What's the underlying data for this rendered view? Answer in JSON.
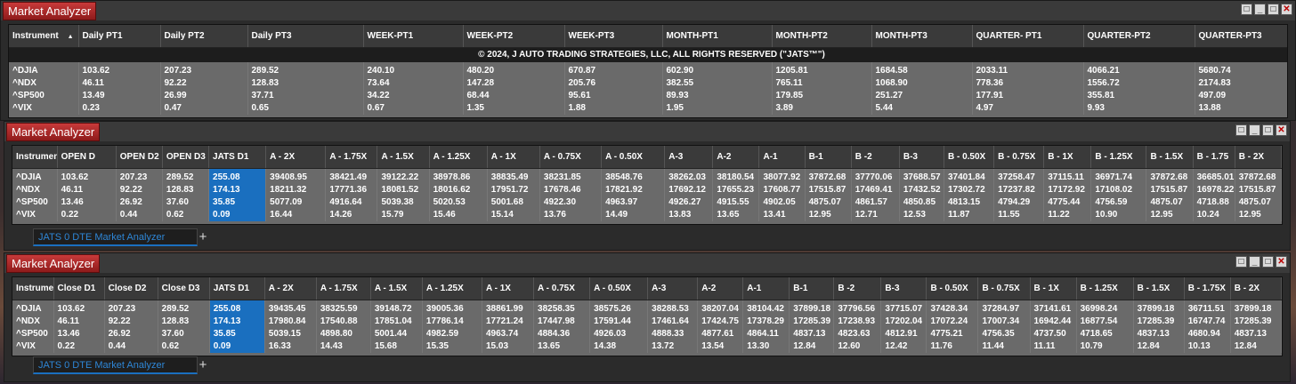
{
  "win1": {
    "title": "Market Analyzer",
    "headers": [
      "Instrument",
      "Daily PT1",
      "Daily PT2",
      "Daily PT3",
      "WEEK-PT1",
      "WEEK-PT2",
      "WEEK-PT3",
      "MONTH-PT1",
      "MONTH-PT2",
      "MONTH-PT3",
      "QUARTER- PT1",
      "QUARTER-PT2",
      "QUARTER-PT3"
    ],
    "sort_indicator": "▲",
    "copyright": "© 2024, J AUTO TRADING STRATEGIES, LLC, ALL RIGHTS RESERVED (\"JATS™\")",
    "rows": [
      [
        "^DJIA",
        "103.62",
        "207.23",
        "289.52",
        "240.10",
        "480.20",
        "670.87",
        "602.90",
        "1205.81",
        "1684.58",
        "2033.11",
        "4066.21",
        "5680.74"
      ],
      [
        "^NDX",
        "46.11",
        "92.22",
        "128.83",
        "73.64",
        "147.28",
        "205.76",
        "382.55",
        "765.11",
        "1068.90",
        "778.36",
        "1556.72",
        "2174.83"
      ],
      [
        "^SP500",
        "13.49",
        "26.99",
        "37.71",
        "34.22",
        "68.44",
        "95.61",
        "89.93",
        "179.85",
        "251.27",
        "177.91",
        "355.81",
        "497.09"
      ],
      [
        "^VIX",
        "0.23",
        "0.47",
        "0.65",
        "0.67",
        "1.35",
        "1.88",
        "1.95",
        "3.89",
        "5.44",
        "4.97",
        "9.93",
        "13.88"
      ]
    ]
  },
  "win2": {
    "title": "Market Analyzer",
    "headers": [
      "Instrument",
      "OPEN D",
      "OPEN D2",
      "OPEN D3",
      "JATS D1",
      "A - 2X",
      "A - 1.75X",
      "A - 1.5X",
      "A - 1.25X",
      "A - 1X",
      "A - 0.75X",
      "A - 0.50X",
      "A-3",
      "A-2",
      "A-1",
      "B-1",
      "B -2",
      "B-3",
      "B - 0.50X",
      "B - 0.75X",
      "B - 1X",
      "B - 1.25X",
      "B - 1.5X",
      "B - 1.75",
      "B - 2X"
    ],
    "rows": [
      [
        "^DJIA",
        "103.62",
        "207.23",
        "289.52",
        "255.08",
        "39408.95",
        "38421.49",
        "39122.22",
        "38978.86",
        "38835.49",
        "38231.85",
        "38548.76",
        "38262.03",
        "38180.54",
        "38077.92",
        "37872.68",
        "37770.06",
        "37688.57",
        "37401.84",
        "37258.47",
        "37115.11",
        "36971.74",
        "37872.68",
        "36685.01",
        "37872.68"
      ],
      [
        "^NDX",
        "46.11",
        "92.22",
        "128.83",
        "174.13",
        "18211.32",
        "17771.36",
        "18081.52",
        "18016.62",
        "17951.72",
        "17678.46",
        "17821.92",
        "17692.12",
        "17655.23",
        "17608.77",
        "17515.87",
        "17469.41",
        "17432.52",
        "17302.72",
        "17237.82",
        "17172.92",
        "17108.02",
        "17515.87",
        "16978.22",
        "17515.87"
      ],
      [
        "^SP500",
        "13.46",
        "26.92",
        "37.60",
        "35.85",
        "5077.09",
        "4916.64",
        "5039.38",
        "5020.53",
        "5001.68",
        "4922.30",
        "4963.97",
        "4926.27",
        "4915.55",
        "4902.05",
        "4875.07",
        "4861.57",
        "4850.85",
        "4813.15",
        "4794.29",
        "4775.44",
        "4756.59",
        "4875.07",
        "4718.88",
        "4875.07"
      ],
      [
        "^VIX",
        "0.22",
        "0.44",
        "0.62",
        "0.09",
        "16.44",
        "14.26",
        "15.79",
        "15.46",
        "15.14",
        "13.76",
        "14.49",
        "13.83",
        "13.65",
        "13.41",
        "12.95",
        "12.71",
        "12.53",
        "11.87",
        "11.55",
        "11.22",
        "10.90",
        "12.95",
        "10.24",
        "12.95"
      ]
    ],
    "tab_label": "JATS 0 DTE Market Analyzer",
    "tab_add": "+"
  },
  "win3": {
    "title": "Market Analyzer",
    "headers": [
      "Instrument",
      "Close D1",
      "Close D2",
      "Close D3",
      "JATS D1",
      "A - 2X",
      "A - 1.75X",
      "A - 1.5X",
      "A - 1.25X",
      "A - 1X",
      "A - 0.75X",
      "A - 0.50X",
      "A-3",
      "A-2",
      "A-1",
      "B-1",
      "B -2",
      "B-3",
      "B - 0.50X",
      "B - 0.75X",
      "B - 1X",
      "B - 1.25X",
      "B - 1.5X",
      "B - 1.75X",
      "B - 2X"
    ],
    "rows": [
      [
        "^DJIA",
        "103.62",
        "207.23",
        "289.52",
        "255.08",
        "39435.45",
        "38325.59",
        "39148.72",
        "39005.36",
        "38861.99",
        "38258.35",
        "38575.26",
        "38288.53",
        "38207.04",
        "38104.42",
        "37899.18",
        "37796.56",
        "37715.07",
        "37428.34",
        "37284.97",
        "37141.61",
        "36998.24",
        "37899.18",
        "36711.51",
        "37899.18"
      ],
      [
        "^NDX",
        "46.11",
        "92.22",
        "128.83",
        "174.13",
        "17980.84",
        "17540.88",
        "17851.04",
        "17786.14",
        "17721.24",
        "17447.98",
        "17591.44",
        "17461.64",
        "17424.75",
        "17378.29",
        "17285.39",
        "17238.93",
        "17202.04",
        "17072.24",
        "17007.34",
        "16942.44",
        "16877.54",
        "17285.39",
        "16747.74",
        "17285.39"
      ],
      [
        "^SP500",
        "13.46",
        "26.92",
        "37.60",
        "35.85",
        "5039.15",
        "4898.80",
        "5001.44",
        "4982.59",
        "4963.74",
        "4884.36",
        "4926.03",
        "4888.33",
        "4877.61",
        "4864.11",
        "4837.13",
        "4823.63",
        "4812.91",
        "4775.21",
        "4756.35",
        "4737.50",
        "4718.65",
        "4837.13",
        "4680.94",
        "4837.13"
      ],
      [
        "^VIX",
        "0.22",
        "0.44",
        "0.62",
        "0.09",
        "16.33",
        "14.43",
        "15.68",
        "15.35",
        "15.03",
        "13.65",
        "14.38",
        "13.72",
        "13.54",
        "13.30",
        "12.84",
        "12.60",
        "12.42",
        "11.76",
        "11.44",
        "11.11",
        "10.79",
        "12.84",
        "10.13",
        "12.84"
      ]
    ],
    "tab_label": "JATS 0 DTE Market Analyzer",
    "tab_add": "+"
  },
  "colors": {
    "title_red": "#b02020",
    "highlight_blue": "#1a6fbf",
    "grid_gray": "#6a6a6a"
  }
}
